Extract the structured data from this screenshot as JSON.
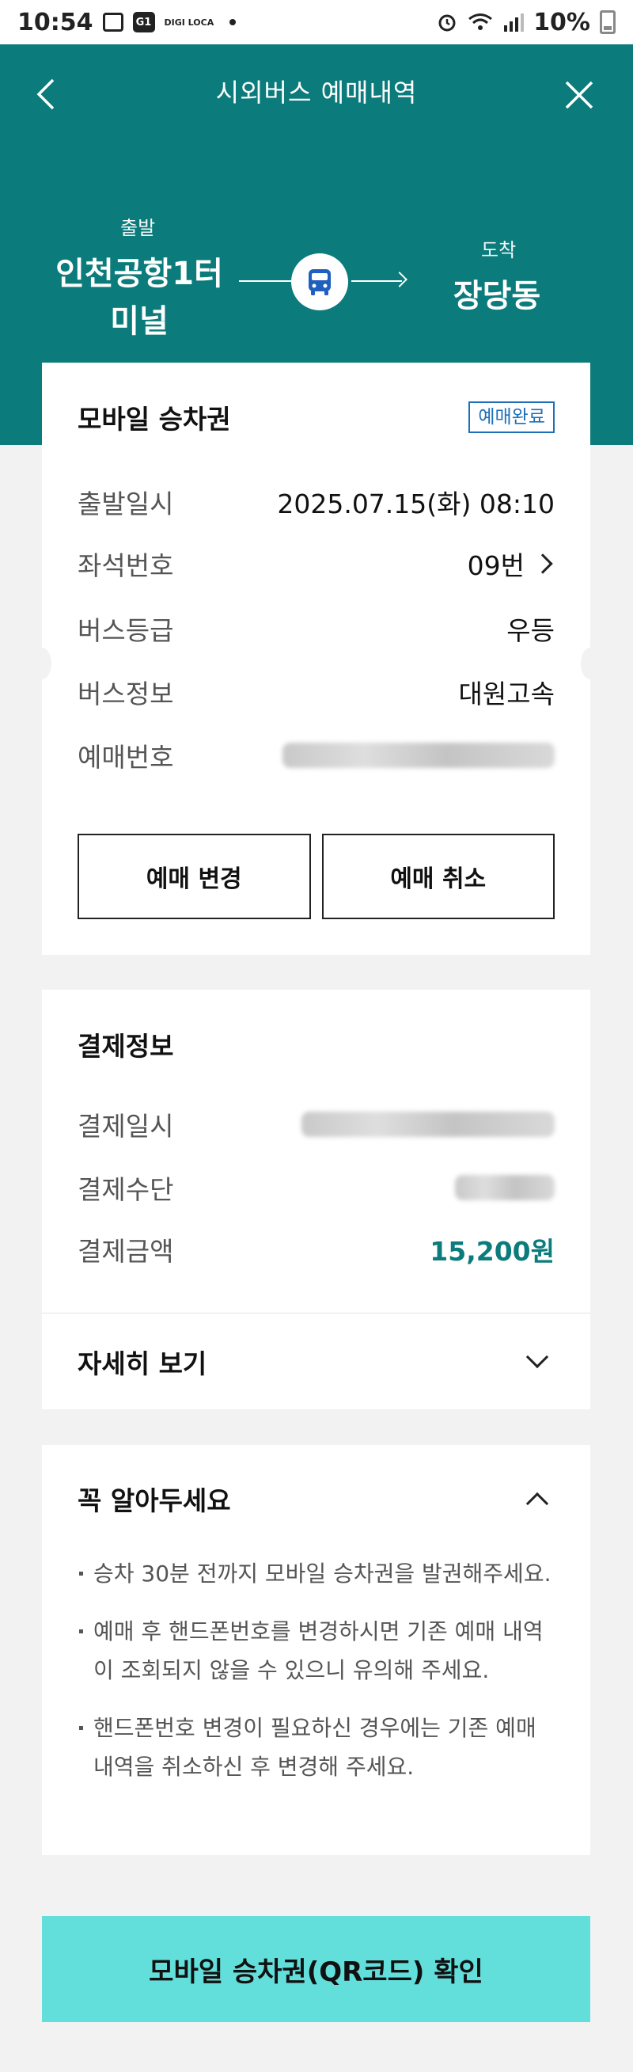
{
  "status_bar": {
    "time": "10:54",
    "app_badge": "G1",
    "app_badge2": "DIGI LOCA",
    "battery": "10%"
  },
  "header": {
    "title": "시외버스 예매내역",
    "departure_label": "출발",
    "departure_name": "인천공항1터미널",
    "arrival_label": "도착",
    "arrival_name": "장당동"
  },
  "ticket": {
    "title": "모바일 승차권",
    "status": "예매완료",
    "rows": [
      {
        "label": "출발일시",
        "value": "2025.07.15(화) 08:10"
      },
      {
        "label": "좌석번호",
        "value": "09번"
      },
      {
        "label": "버스등급",
        "value": "우등"
      },
      {
        "label": "버스정보",
        "value": "대원고속"
      },
      {
        "label": "예매번호",
        "value": ""
      }
    ],
    "change_button": "예매 변경",
    "cancel_button": "예매 취소"
  },
  "payment": {
    "title": "결제정보",
    "rows": [
      {
        "label": "결제일시",
        "value": ""
      },
      {
        "label": "결제수단",
        "value": ""
      },
      {
        "label": "결제금액",
        "value": "15,200원"
      }
    ],
    "details_label": "자세히 보기"
  },
  "notice": {
    "title": "꼭 알아두세요",
    "items": [
      "승차 30분 전까지 모바일 승차권을 발권해주세요.",
      "예매 후 핸드폰번호를 변경하시면 기존 예매 내역이 조회되지 않을 수 있으니 유의해 주세요.",
      "핸드폰번호 변경이 필요하신 경우에는 기존 예매 내역을 취소하신 후 변경해 주세요."
    ]
  },
  "qr_button": "모바일 승차권(QR코드) 확인",
  "colors": {
    "header_bg": "#0b7b7b",
    "badge": "#1e6fb8",
    "amount": "#0b7b7b",
    "qr_button_bg": "#62dedb"
  }
}
